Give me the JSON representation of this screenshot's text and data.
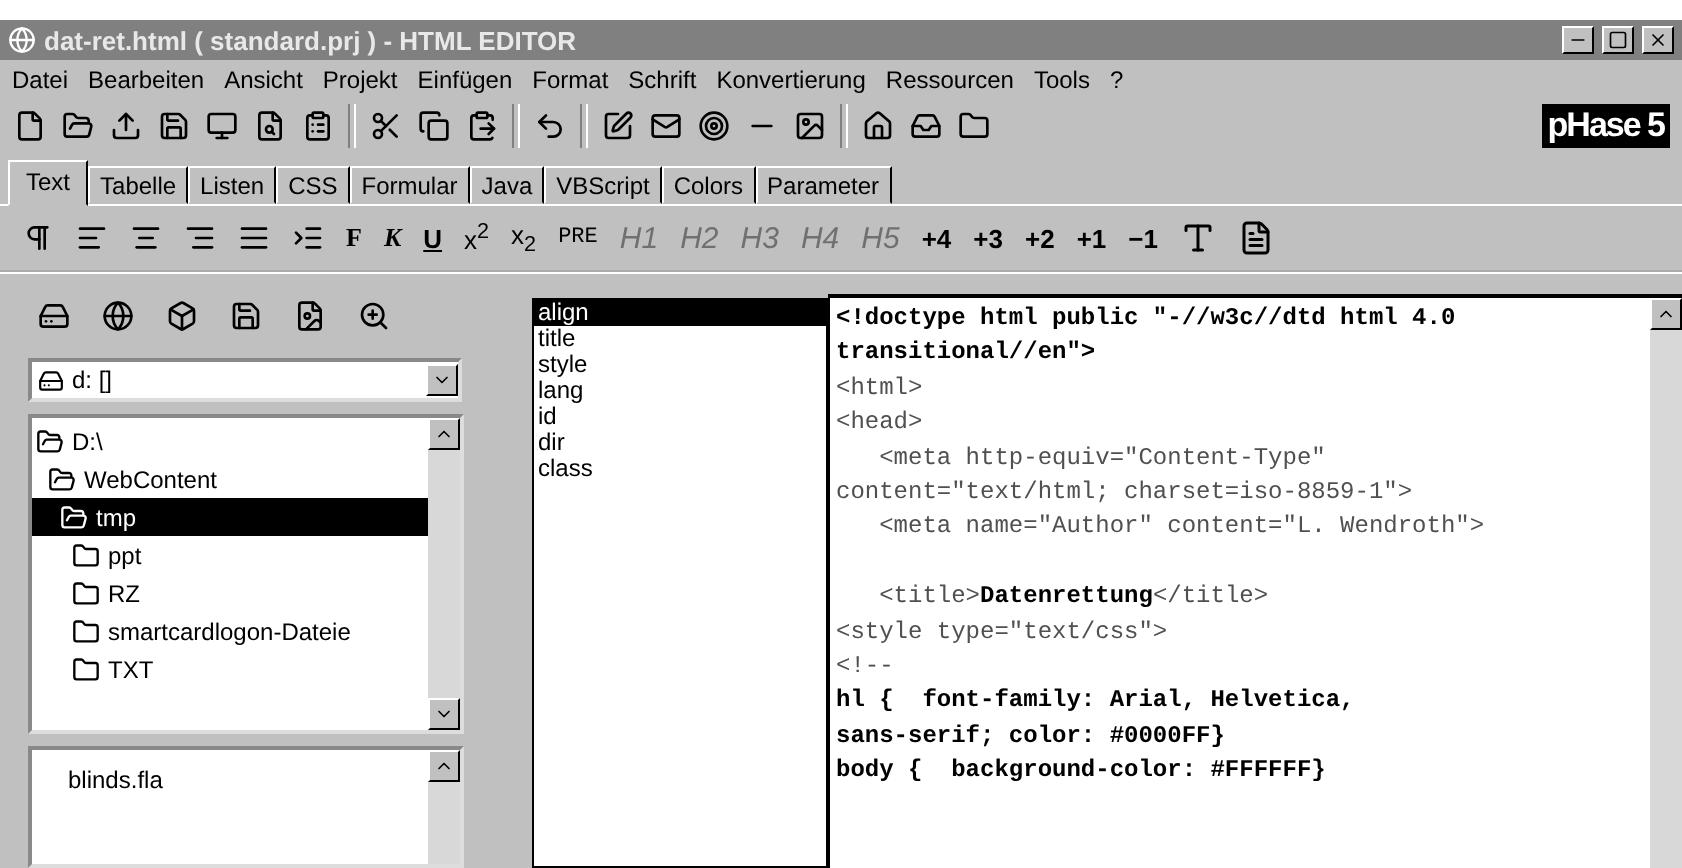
{
  "window": {
    "title": "dat-ret.html  ( standard.prj ) - HTML EDITOR"
  },
  "menu": [
    "Datei",
    "Bearbeiten",
    "Ansicht",
    "Projekt",
    "Einfügen",
    "Format",
    "Schrift",
    "Konvertierung",
    "Ressourcen",
    "Tools",
    "?"
  ],
  "logo": "pHase 5",
  "tabs": [
    {
      "label": "Text",
      "selected": true
    },
    {
      "label": "Tabelle",
      "selected": false
    },
    {
      "label": "Listen",
      "selected": false
    },
    {
      "label": "CSS",
      "selected": false
    },
    {
      "label": "Formular",
      "selected": false
    },
    {
      "label": "Java",
      "selected": false
    },
    {
      "label": "VBScript",
      "selected": false
    },
    {
      "label": "Colors",
      "selected": false
    },
    {
      "label": "Parameter",
      "selected": false
    }
  ],
  "format_buttons": [
    {
      "label": "F",
      "kind": "bold"
    },
    {
      "label": "K",
      "kind": "italic"
    },
    {
      "label": "U",
      "kind": "underline"
    },
    {
      "label": "x$^{2}$",
      "kind": "plain"
    },
    {
      "label": "x$_{2}$",
      "kind": "plain"
    },
    {
      "label": "PRE",
      "kind": "mono"
    },
    {
      "label": "H1",
      "kind": "heading"
    },
    {
      "label": "H2",
      "kind": "heading"
    },
    {
      "label": "H3",
      "kind": "heading"
    },
    {
      "label": "H4",
      "kind": "heading"
    },
    {
      "label": "H5",
      "kind": "heading"
    },
    {
      "label": "+4",
      "kind": "size"
    },
    {
      "label": "+3",
      "kind": "size"
    },
    {
      "label": "+2",
      "kind": "size"
    },
    {
      "label": "+1",
      "kind": "size"
    },
    {
      "label": "−1",
      "kind": "size"
    }
  ],
  "drive_select": {
    "value": "d: []"
  },
  "folder_tree": [
    {
      "label": "D:\\",
      "expanded": true,
      "selected": false,
      "children": [
        {
          "label": "WebContent",
          "expanded": true,
          "selected": false,
          "children": [
            {
              "label": "tmp",
              "expanded": true,
              "selected": true,
              "children": [
                {
                  "label": "ppt",
                  "expanded": false,
                  "selected": false
                },
                {
                  "label": "RZ",
                  "expanded": false,
                  "selected": false
                },
                {
                  "label": "smartcardlogon-Dateie",
                  "expanded": false,
                  "selected": false
                },
                {
                  "label": "TXT",
                  "expanded": false,
                  "selected": false
                }
              ]
            }
          ]
        }
      ]
    }
  ],
  "file_list": [
    "blinds.fla"
  ],
  "attributes": [
    {
      "label": "align",
      "selected": true
    },
    {
      "label": "title",
      "selected": false
    },
    {
      "label": "style",
      "selected": false
    },
    {
      "label": "lang",
      "selected": false
    },
    {
      "label": "id",
      "selected": false
    },
    {
      "label": "dir",
      "selected": false
    },
    {
      "label": "class",
      "selected": false
    }
  ],
  "code_lines": [
    [
      {
        "text": "<!doctype html public \"-//w3c//dtd html 4.0",
        "kind": "text"
      }
    ],
    [
      {
        "text": "transitional//en\">",
        "kind": "text"
      }
    ],
    [
      {
        "text": "<html>",
        "kind": "tag"
      }
    ],
    [
      {
        "text": "<head>",
        "kind": "tag"
      }
    ],
    [
      {
        "text": "   <meta http-equiv=\"Content-Type\"",
        "kind": "tag"
      }
    ],
    [
      {
        "text": "content=\"text/html; charset=iso-8859-1\">",
        "kind": "tag"
      }
    ],
    [
      {
        "text": "   <meta name=\"Author\" content=\"L. Wendroth\">",
        "kind": "tag"
      }
    ],
    {
      "kind": "blank"
    },
    [
      {
        "text": "   <title>",
        "kind": "tag"
      },
      {
        "text": "Datenrettung",
        "kind": "text"
      },
      {
        "text": "</title>",
        "kind": "tag"
      }
    ],
    [
      {
        "text": "<style type=\"text/css\">",
        "kind": "tag"
      }
    ],
    [
      {
        "text": "<!--",
        "kind": "tag"
      }
    ],
    [
      {
        "text": "hl {  font-family: Arial, Helvetica,",
        "kind": "text"
      }
    ],
    [
      {
        "text": "sans-serif; color: #0000FF}",
        "kind": "text"
      }
    ],
    [
      {
        "text": "body {  background-color: #FFFFFF}",
        "kind": "text"
      }
    ]
  ]
}
